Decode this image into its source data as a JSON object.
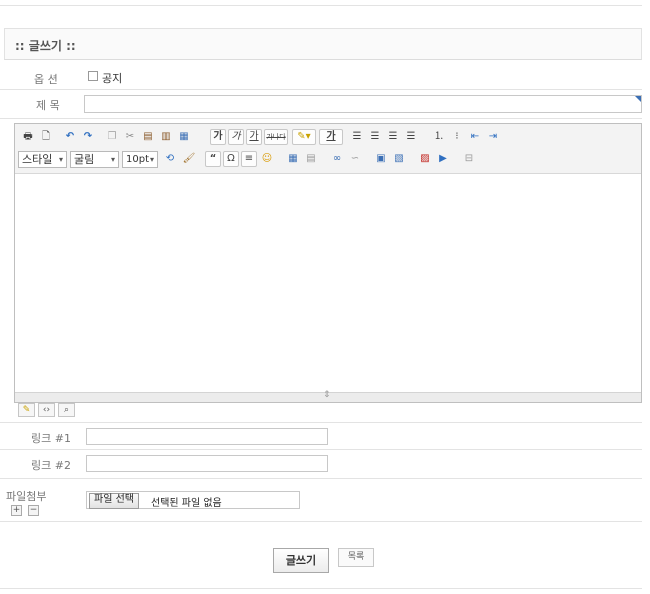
{
  "header": {
    "title": ":: 글쓰기 ::"
  },
  "options": {
    "label": "옵 션",
    "notice_label": "공지"
  },
  "subject": {
    "label": "제 목",
    "value": ""
  },
  "editor": {
    "combo_style": "스타일",
    "combo_font": "굴림",
    "combo_size": "10pt",
    "tb_bold": "가",
    "tb_italic": "가",
    "tb_underline": "가",
    "tb_strike": "가나다",
    "tb_fontcolor": "가",
    "tb_quote": "“",
    "tb_omega": "Ω",
    "content": ""
  },
  "links": [
    {
      "label": "링크 #1",
      "value": ""
    },
    {
      "label": "링크 #2",
      "value": ""
    }
  ],
  "attach": {
    "label": "파일첨부",
    "add": "+",
    "remove": "−",
    "button": "파일 선택",
    "status": "선택된 파일 없음"
  },
  "actions": {
    "submit": "글쓰기",
    "list": "목록"
  },
  "colors": {
    "accent": "#3b6fb5",
    "border": "#c8c8c8"
  }
}
